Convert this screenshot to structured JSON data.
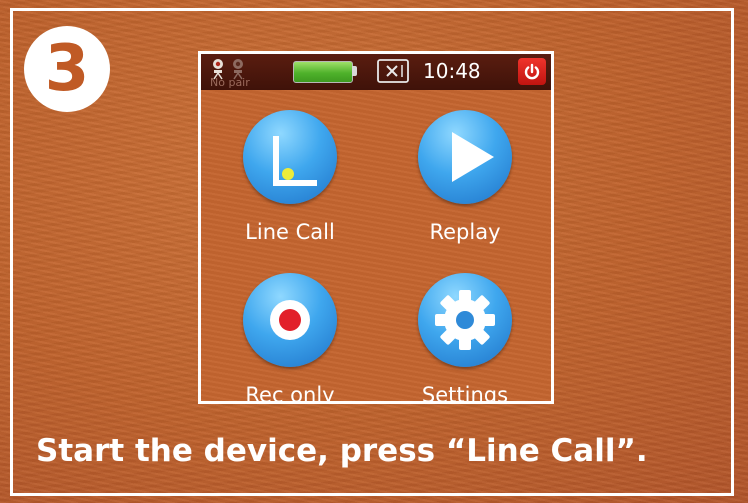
{
  "step": {
    "number": "3"
  },
  "caption": "Start the device, press “Line Call”.",
  "status_bar": {
    "pair_status": "No pair",
    "time": "10:48",
    "battery_level": 1.0,
    "icons": [
      "camera-icon",
      "camera-icon",
      "battery-icon",
      "sd-card-icon",
      "power-icon"
    ]
  },
  "apps": [
    {
      "label": "Line Call",
      "icon": "line-call-icon"
    },
    {
      "label": "Replay",
      "icon": "play-icon"
    },
    {
      "label": "Rec only",
      "icon": "record-icon"
    },
    {
      "label": "Settings",
      "icon": "gear-icon"
    }
  ],
  "colors": {
    "background": "#c0622c",
    "status_bar": "#4a160c",
    "app_icon_blue": "#3fa7ee",
    "power_red": "#e0221c",
    "battery_green": "#5cc232",
    "record_red": "#e2202a"
  }
}
